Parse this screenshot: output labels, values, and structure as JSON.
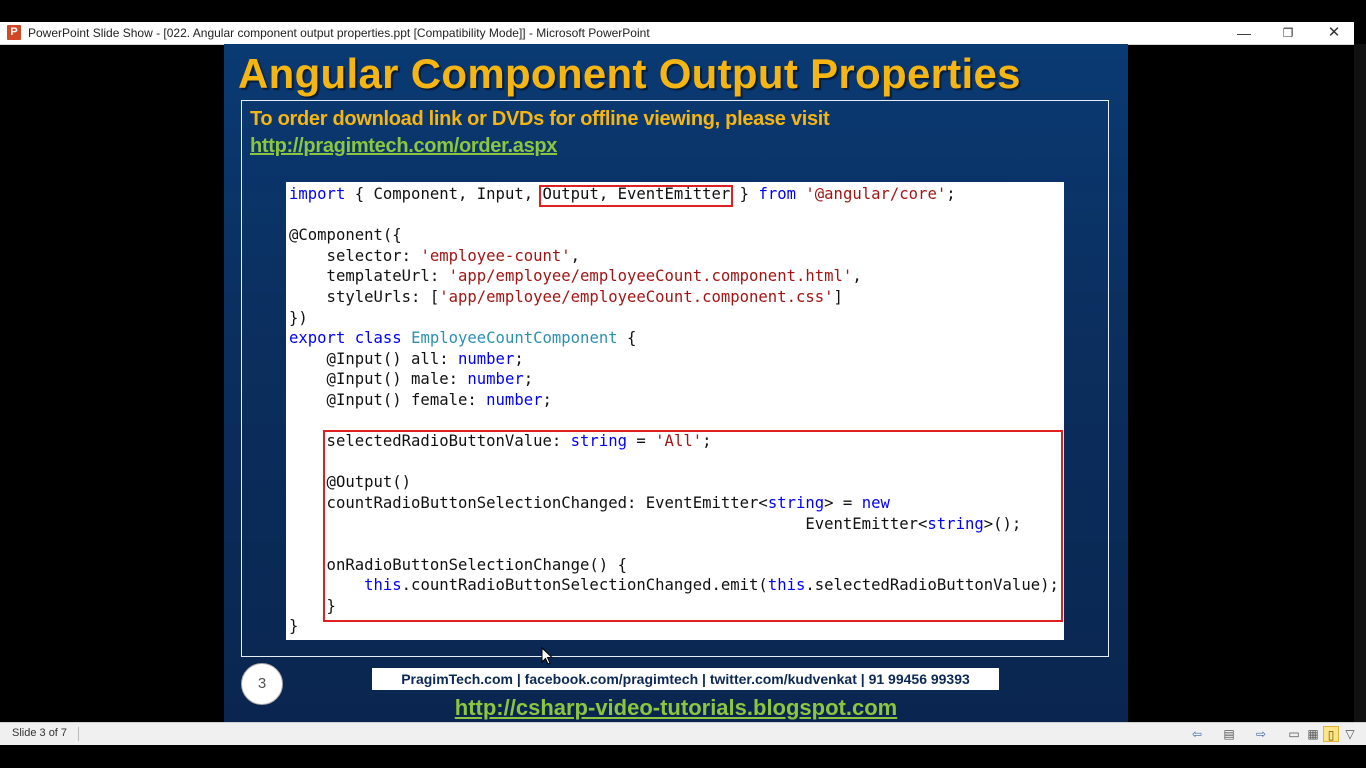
{
  "window": {
    "app_icon": "P",
    "title": "PowerPoint Slide Show - [022. Angular component output properties.ppt [Compatibility Mode]] - Microsoft PowerPoint",
    "minimize": "—",
    "maximize": "❐",
    "close": "✕"
  },
  "slide": {
    "title": "Angular Component Output Properties",
    "order_text": "To order download link or DVDs for offline viewing, please visit",
    "order_link": "http://pragimtech.com/order.aspx",
    "number": "3",
    "footer": "PragimTech.com | facebook.com/pragimtech | twitter.com/kudvenkat | 91 99456 99393",
    "blog_link": "http://csharp-video-tutorials.blogspot.com"
  },
  "code": {
    "line1_import": "import",
    "line1_a": " { Component, Input, ",
    "line1_highlight": "Output, EventEmitter",
    "line1_b": " } ",
    "line1_from": "from",
    "line1_module": "'@angular/core'",
    "line1_end": ";",
    "decorator": "@Component({",
    "selector_key": "    selector: ",
    "selector_val": "'employee-count'",
    "template_key": "    templateUrl: ",
    "template_val": "'app/employee/employeeCount.component.html'",
    "style_key": "    styleUrls: [",
    "style_val": "'app/employee/employeeCount.component.css'",
    "style_end": "]",
    "close_decorator": "})",
    "export_kw": "export class",
    "class_name": "EmployeeCountComponent",
    "class_open": " {",
    "input_all": "    @Input() all: ",
    "input_male": "    @Input() male: ",
    "input_female": "    @Input() female: ",
    "type_number": "number",
    "semicolon": ";",
    "selected_key": "    selectedRadioButtonValue: ",
    "type_string": "string",
    "selected_eq": " = ",
    "selected_val": "'All'",
    "output_dec": "    @Output()",
    "emitter_key": "    countRadioButtonSelectionChanged: EventEmitter<",
    "emitter_mid": "> = ",
    "new_kw": "new",
    "emitter_indent": "                                                       EventEmitter<",
    "emitter_end": ">();",
    "method_sig": "    onRadioButtonSelectionChange() {",
    "emit_indent": "        ",
    "this_kw": "this",
    "emit_call": ".countRadioButtonSelectionChanged.emit(",
    "emit_arg": ".selectedRadioButtonValue);",
    "method_close": "    }",
    "class_close": "}"
  },
  "statusbar": {
    "slide_counter": "Slide 3 of 7"
  }
}
